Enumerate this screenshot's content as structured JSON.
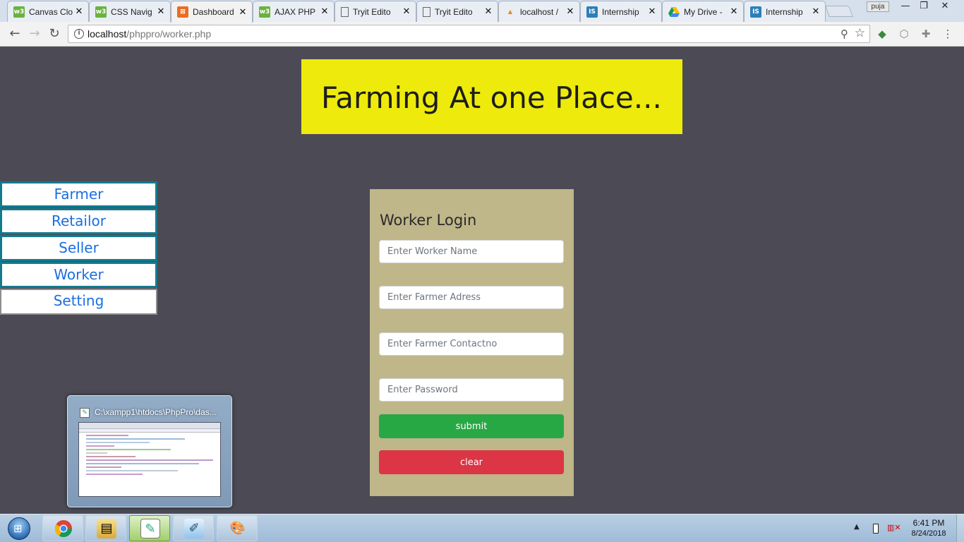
{
  "browser": {
    "tabs": [
      {
        "title": "Canvas Clo",
        "icon": "w3schools-icon"
      },
      {
        "title": "CSS Navig",
        "icon": "w3schools-icon"
      },
      {
        "title": "Dashboard",
        "icon": "xampp-icon",
        "active": true
      },
      {
        "title": "AJAX PHP",
        "icon": "w3schools-icon"
      },
      {
        "title": "Tryit Edito",
        "icon": "document-icon"
      },
      {
        "title": "Tryit Edito",
        "icon": "document-icon"
      },
      {
        "title": "localhost /",
        "icon": "phpmyadmin-icon"
      },
      {
        "title": "Internship",
        "icon": "internshala-icon"
      },
      {
        "title": "My Drive -",
        "icon": "google-drive-icon"
      },
      {
        "title": "Internship",
        "icon": "internshala-icon"
      }
    ],
    "profile_name": "puja",
    "url_host": "localhost",
    "url_path": "/phppro/worker.php"
  },
  "page": {
    "banner_title": "Farming At one Place...",
    "nav": [
      {
        "label": "Farmer"
      },
      {
        "label": "Retailor"
      },
      {
        "label": "Seller"
      },
      {
        "label": "Worker"
      },
      {
        "label": "Setting"
      }
    ],
    "login": {
      "heading": "Worker Login",
      "fields": [
        {
          "placeholder": "Enter Worker Name",
          "value": ""
        },
        {
          "placeholder": "Enter Farmer Adress",
          "value": ""
        },
        {
          "placeholder": "Enter Farmer Contactno",
          "value": ""
        },
        {
          "placeholder": "Enter Password",
          "value": ""
        }
      ],
      "submit_label": "submit",
      "clear_label": "clear"
    },
    "colors": {
      "background": "#4b4a55",
      "banner": "#eeeb0c",
      "login_panel": "#bfb68a",
      "submit": "#28a745",
      "clear": "#dc3545",
      "nav_text": "#1a6fe0",
      "nav_border": "#137a8f"
    }
  },
  "taskbar": {
    "thumbnail_title": "C:\\xampp1\\htdocs\\PhpPro\\das...",
    "pinned": [
      {
        "icon": "chrome-icon"
      },
      {
        "icon": "file-explorer-icon"
      },
      {
        "icon": "notepad-plus-plus-icon",
        "active": true
      },
      {
        "icon": "notepad-icon"
      },
      {
        "icon": "paint-icon"
      }
    ],
    "clock_time": "6:41 PM",
    "clock_date": "8/24/2018"
  }
}
